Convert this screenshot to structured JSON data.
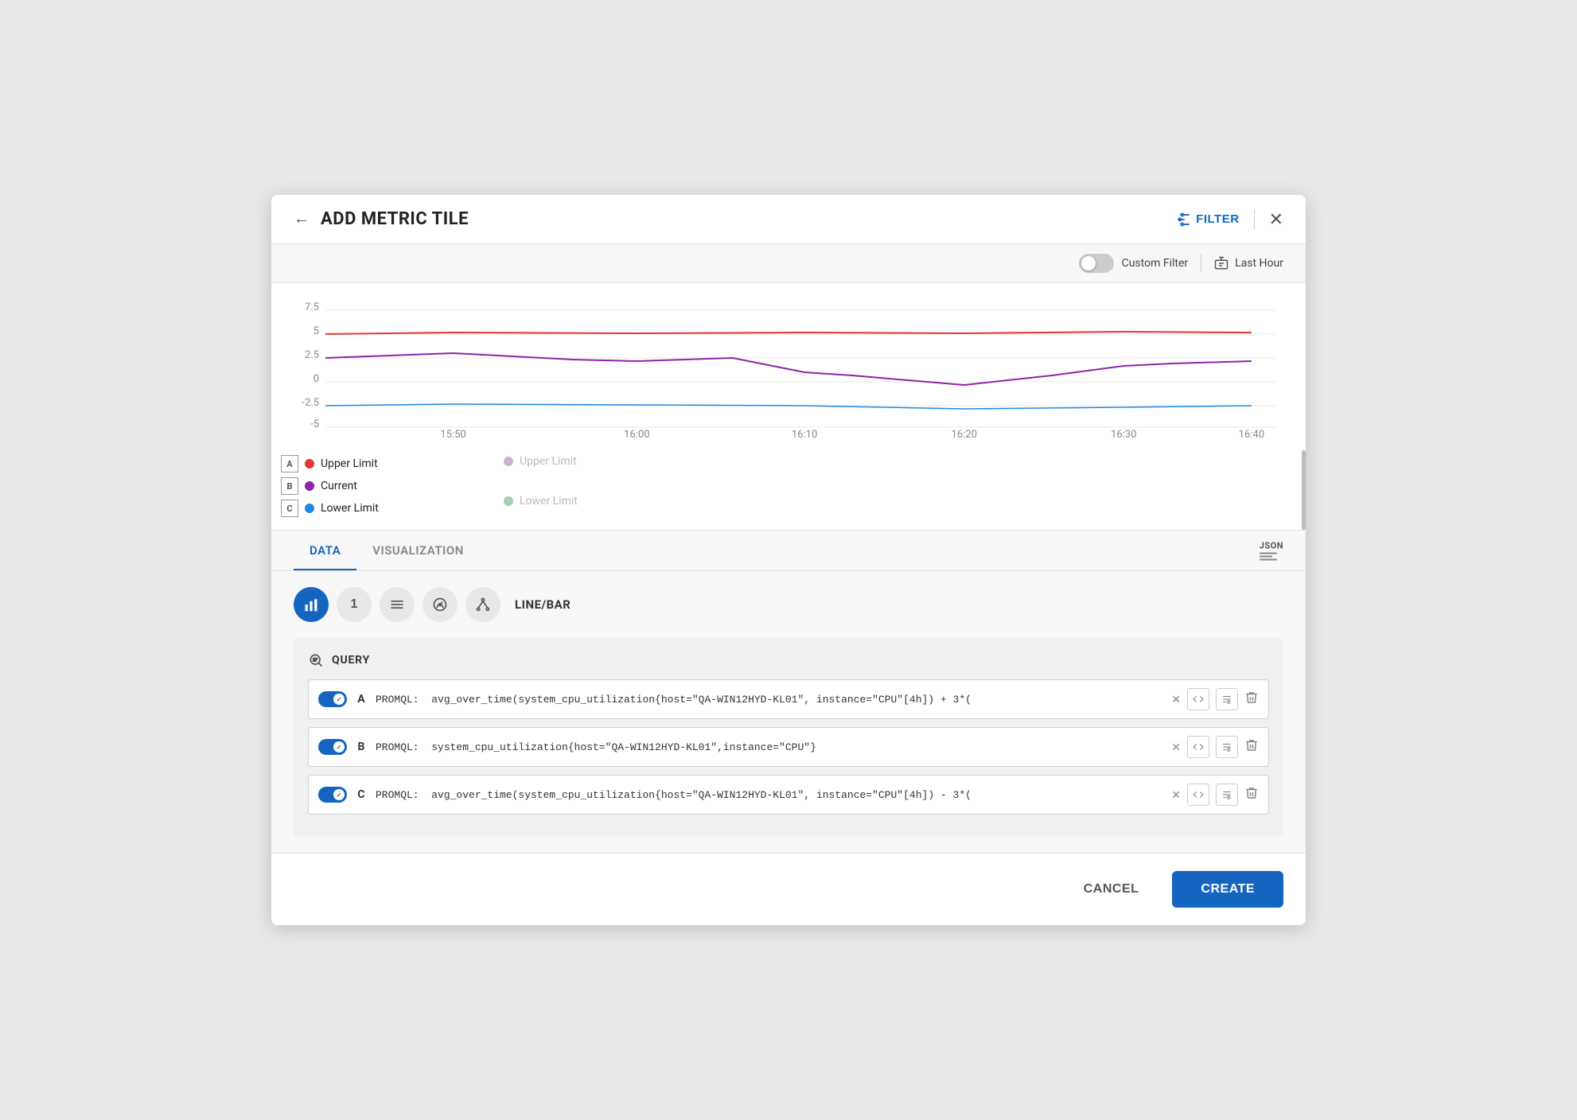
{
  "header": {
    "back_label": "←",
    "title": "ADD METRIC TILE",
    "filter_label": "FILTER",
    "close_label": "✕"
  },
  "filter_bar": {
    "custom_filter_label": "Custom Filter",
    "time_filter_label": "Last Hour"
  },
  "legend": {
    "col1": [
      {
        "box": "A",
        "color": "#e53935",
        "label": "Upper Limit"
      },
      {
        "box": "B",
        "color": "#8e24aa",
        "label": "Current"
      },
      {
        "box": "C",
        "color": "#1e88e5",
        "label": "Lower Limit"
      }
    ],
    "col2": [
      {
        "label": "Upper Limit"
      },
      {
        "label": ""
      },
      {
        "label": "Lower Limit"
      }
    ]
  },
  "tabs": {
    "items": [
      {
        "label": "DATA",
        "active": true
      },
      {
        "label": "VISUALIZATION",
        "active": false
      }
    ],
    "json_label": "JSON"
  },
  "chart_types": [
    {
      "icon": "bar",
      "label": "bar-chart-icon",
      "active": true
    },
    {
      "icon": "1",
      "label": "single-value-icon",
      "active": false
    },
    {
      "icon": "list",
      "label": "list-icon",
      "active": false
    },
    {
      "icon": "gauge",
      "label": "gauge-icon",
      "active": false
    },
    {
      "icon": "nodes",
      "label": "nodes-icon",
      "active": false
    }
  ],
  "chart_type_label": "LINE/BAR",
  "query_section": {
    "title": "QUERY",
    "rows": [
      {
        "letter": "A",
        "promql": "PROMQL:",
        "query": "avg_over_time(system_cpu_utilization{host=\"QA-WIN12HYD-KL01\", instance=\"CPU\"[4h]) + 3*("
      },
      {
        "letter": "B",
        "promql": "PROMQL:",
        "query": "system_cpu_utilization{host=\"QA-WIN12HYD-KL01\",instance=\"CPU\"}"
      },
      {
        "letter": "C",
        "promql": "PROMQL:",
        "query": "avg_over_time(system_cpu_utilization{host=\"QA-WIN12HYD-KL01\", instance=\"CPU\"[4h]) - 3*("
      }
    ]
  },
  "footer": {
    "cancel_label": "CANCEL",
    "create_label": "CREATE"
  },
  "chart": {
    "y_axis": [
      "7.5",
      "5",
      "2.5",
      "0",
      "-2.5",
      "-5"
    ],
    "x_axis": [
      "15:50",
      "16:00",
      "16:10",
      "16:20",
      "16:30",
      "16:40"
    ]
  }
}
